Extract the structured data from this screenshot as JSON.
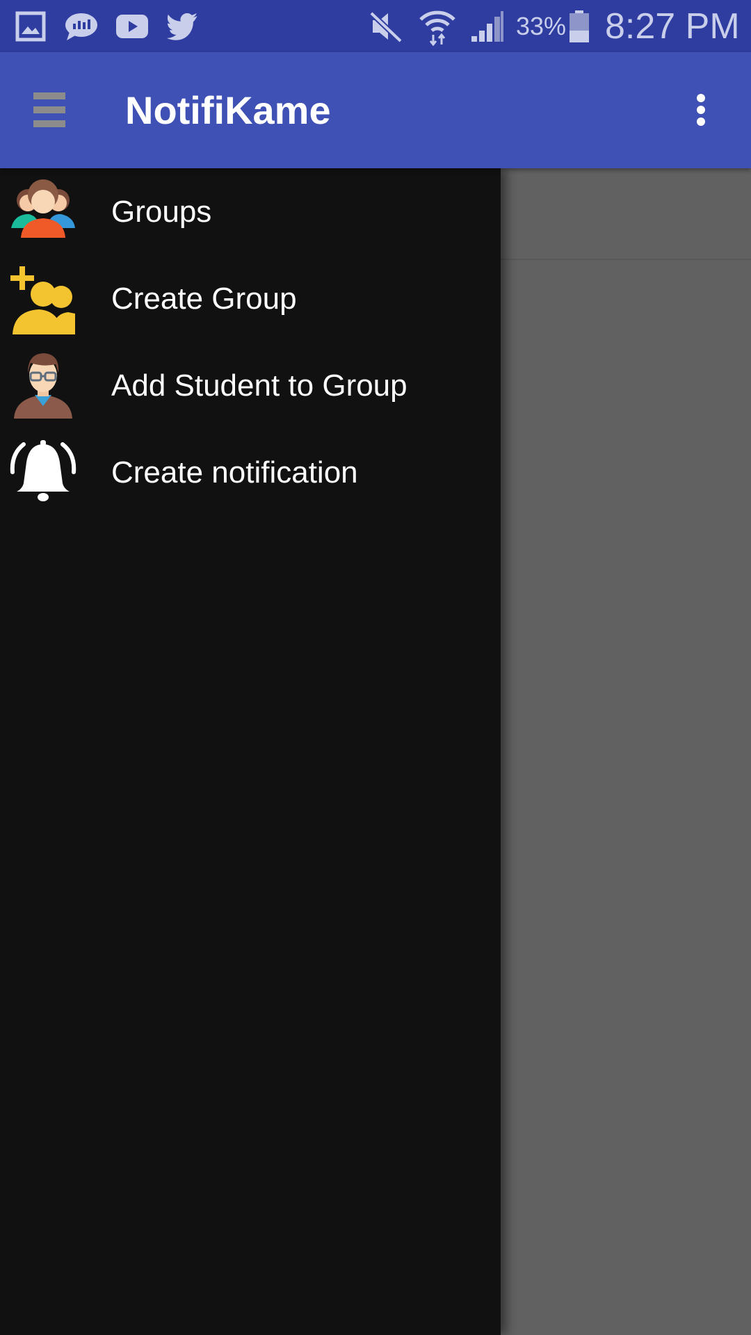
{
  "status_bar": {
    "battery_percent": "33%",
    "time": "8:27 PM",
    "left_icons": [
      "gallery-icon",
      "sms-icon",
      "youtube-icon",
      "twitter-icon"
    ],
    "right_icons": [
      "mute-icon",
      "wifi-icon",
      "signal-icon",
      "battery-icon"
    ]
  },
  "app_bar": {
    "title": "NotifiKame",
    "menu_icon": "hamburger-icon",
    "overflow_icon": "more-vert-icon"
  },
  "drawer": {
    "items": [
      {
        "label": "Groups",
        "icon": "groups-icon"
      },
      {
        "label": "Create Group",
        "icon": "create-group-icon"
      },
      {
        "label": "Add Student to Group",
        "icon": "add-student-icon"
      },
      {
        "label": "Create notification",
        "icon": "bell-icon"
      }
    ]
  },
  "colors": {
    "status_bar": "#2f3da0",
    "app_bar": "#3f51b5",
    "drawer_bg": "#111111",
    "scrim": "#616161"
  }
}
